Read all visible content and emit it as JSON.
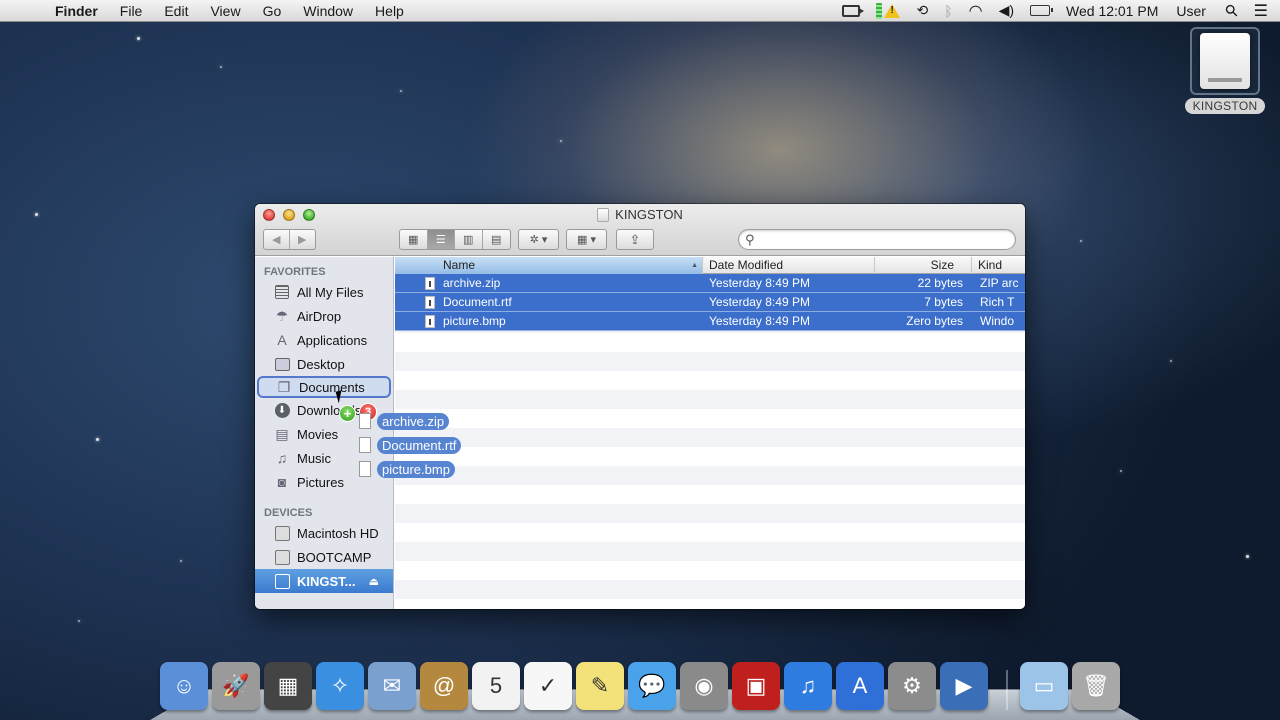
{
  "menubar": {
    "apple": "",
    "app_name": "Finder",
    "menus": [
      "File",
      "Edit",
      "View",
      "Go",
      "Window",
      "Help"
    ],
    "status_icons": [
      "screen-recorder-icon",
      "gpu-status-icon",
      "warning-icon",
      "time-machine-icon",
      "bluetooth-icon",
      "wifi-icon",
      "volume-icon",
      "battery-icon"
    ],
    "clock": "Wed 12:01 PM",
    "user": "User",
    "spotlight_glyph": "⚲",
    "notification_glyph": "☰"
  },
  "desktop": {
    "disk_label": "KINGSTON"
  },
  "window": {
    "title": "KINGSTON",
    "toolbar": {
      "back": "◀",
      "forward": "▶",
      "view_icon": "▦",
      "view_list": "☰",
      "view_columns": "▥",
      "view_coverflow": "▤",
      "action": "✲ ▾",
      "arrange": "▦ ▾",
      "share": "⇪"
    },
    "search": {
      "placeholder": "",
      "value": ""
    },
    "sidebar": {
      "favorites_header": "FAVORITES",
      "favorites": [
        {
          "label": "All My Files",
          "icon": "all-files-icon"
        },
        {
          "label": "AirDrop",
          "icon": "airdrop-icon"
        },
        {
          "label": "Applications",
          "icon": "applications-icon"
        },
        {
          "label": "Desktop",
          "icon": "desktop-icon"
        },
        {
          "label": "Documents",
          "icon": "documents-icon"
        },
        {
          "label": "Downloads",
          "icon": "downloads-icon"
        },
        {
          "label": "Movies",
          "icon": "movies-icon"
        },
        {
          "label": "Music",
          "icon": "music-icon"
        },
        {
          "label": "Pictures",
          "icon": "pictures-icon"
        }
      ],
      "devices_header": "DEVICES",
      "devices": [
        {
          "label": "Macintosh HD",
          "icon": "hard-drive-icon"
        },
        {
          "label": "BOOTCAMP",
          "icon": "hard-drive-icon"
        },
        {
          "label": "KINGST...",
          "icon": "usb-drive-icon",
          "eject": "⏏"
        }
      ]
    },
    "list": {
      "columns": [
        "Name",
        "Date Modified",
        "Size",
        "Kind"
      ],
      "sorted_column": "Name",
      "rows": [
        {
          "name": "archive.zip",
          "date": "Yesterday 8:49 PM",
          "size": "22 bytes",
          "kind": "ZIP arc"
        },
        {
          "name": "Document.rtf",
          "date": "Yesterday 8:49 PM",
          "size": "7 bytes",
          "kind": "Rich T"
        },
        {
          "name": "picture.bmp",
          "date": "Yesterday 8:49 PM",
          "size": "Zero bytes",
          "kind": "Windo"
        }
      ]
    }
  },
  "drag": {
    "plus": "+",
    "count": "3",
    "items": [
      "archive.zip",
      "Document.rtf",
      "picture.bmp"
    ]
  },
  "dock": {
    "apps": [
      {
        "name": "Finder",
        "glyph": "☺",
        "color": "#5b8fd8"
      },
      {
        "name": "Launchpad",
        "glyph": "🚀",
        "color": "#9a9a9a"
      },
      {
        "name": "Mission Control",
        "glyph": "▦",
        "color": "#444"
      },
      {
        "name": "Safari",
        "glyph": "✧",
        "color": "#3a8fe0"
      },
      {
        "name": "Mail",
        "glyph": "✉",
        "color": "#7aa0d0"
      },
      {
        "name": "Contacts",
        "glyph": "@",
        "color": "#b4893f"
      },
      {
        "name": "Calendar",
        "glyph": "5",
        "color": "#f2f2f2"
      },
      {
        "name": "Reminders",
        "glyph": "✓",
        "color": "#f7f7f7"
      },
      {
        "name": "Notes",
        "glyph": "✎",
        "color": "#f3e27a"
      },
      {
        "name": "Messages",
        "glyph": "💬",
        "color": "#4aa2ea"
      },
      {
        "name": "FaceTime",
        "glyph": "◉",
        "color": "#8a8a8a"
      },
      {
        "name": "Photo Booth",
        "glyph": "▣",
        "color": "#c0201d"
      },
      {
        "name": "iTunes",
        "glyph": "♫",
        "color": "#2f7ce0"
      },
      {
        "name": "App Store",
        "glyph": "A",
        "color": "#2f6fd8"
      },
      {
        "name": "System Preferences",
        "glyph": "⚙",
        "color": "#8c8c8c"
      },
      {
        "name": "iPhoto",
        "glyph": "▶",
        "color": "#3a6fb8"
      }
    ],
    "documents": {
      "name": "Documents Stack",
      "glyph": "▭",
      "color": "#9cc3e8"
    },
    "trash": {
      "name": "Trash",
      "glyph": "🗑",
      "color": "#a8a8a8"
    }
  }
}
